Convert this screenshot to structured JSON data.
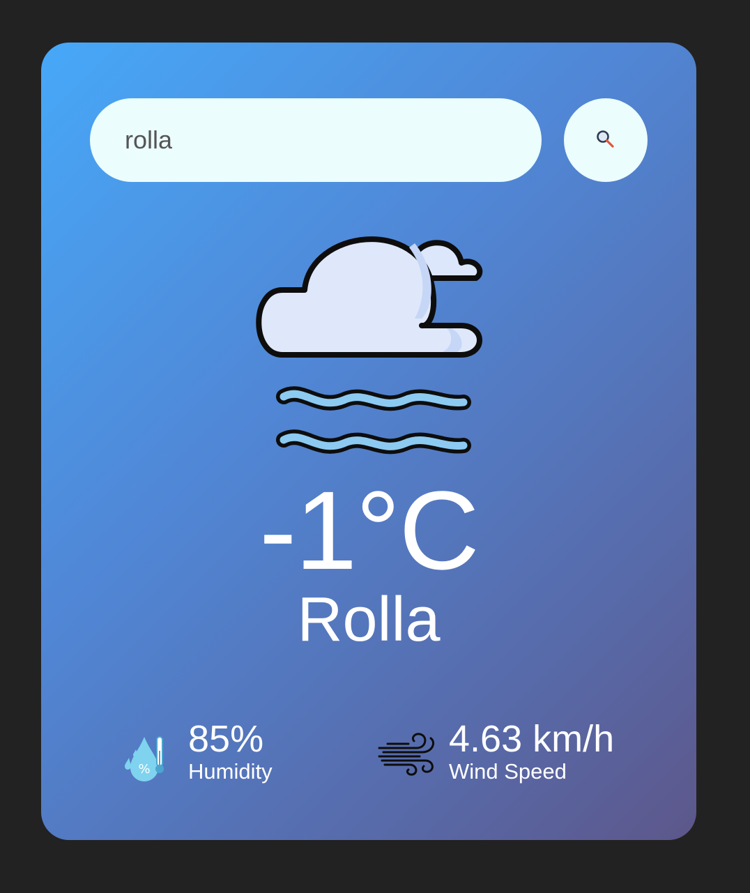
{
  "search": {
    "value": "rolla",
    "button_icon": "search-icon"
  },
  "weather": {
    "icon": "mist-cloud-icon",
    "temperature": "-1°C",
    "city": "Rolla"
  },
  "humidity": {
    "icon": "humidity-icon",
    "value": "85%",
    "label": "Humidity"
  },
  "wind": {
    "icon": "wind-icon",
    "value": "4.63 km/h",
    "label": "Wind Speed"
  },
  "colors": {
    "background": "#222222",
    "card_gradient_start": "#47a8f8",
    "card_gradient_end": "#5d578a",
    "input_background": "#ebfdfc",
    "text": "#ffffff"
  }
}
